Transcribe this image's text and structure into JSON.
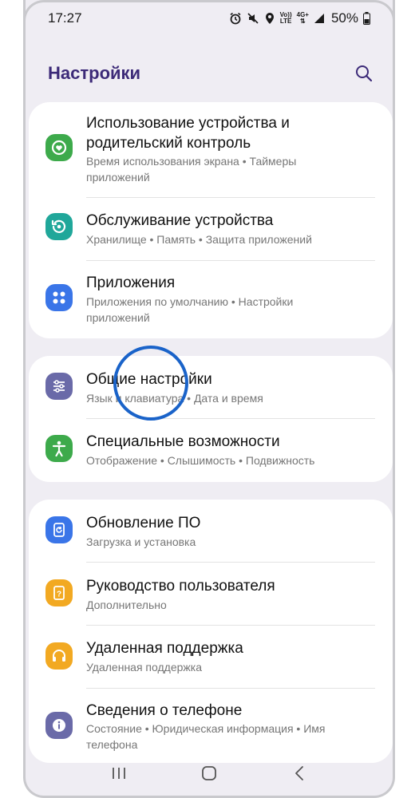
{
  "status_bar": {
    "time": "17:27",
    "volte_top": "Vo))",
    "volte_bottom": "LTE",
    "network_top": "4G+",
    "battery": "50%"
  },
  "header": {
    "title": "Настройки",
    "search_icon": "search-icon"
  },
  "colors": {
    "title": "#3c2a78",
    "background": "#efedf3",
    "tap_indicator": "#1a63c9"
  },
  "groups": [
    {
      "items": [
        {
          "title_line1": "Использование устройства и",
          "title_line2": "родительский контроль",
          "sub_line1": "Время использования экрана • Таймеры",
          "sub_line2": "приложений",
          "icon": "digital-wellbeing-icon",
          "color": "#3daa4b"
        },
        {
          "title_line1": "Обслуживание устройства",
          "sub_line1": "Хранилище • Память • Защита приложений",
          "icon": "device-care-icon",
          "color": "#20a79a"
        },
        {
          "title_line1": "Приложения",
          "sub_line1": "Приложения по умолчанию • Настройки",
          "sub_line2": "приложений",
          "icon": "apps-icon",
          "color": "#3a75e8"
        }
      ]
    },
    {
      "items": [
        {
          "title_line1": "Общие настройки",
          "sub_line1": "Язык и клавиатура • Дата и время",
          "icon": "general-settings-icon",
          "color": "#6a6aa8"
        },
        {
          "title_line1": "Специальные возможности",
          "sub_line1": "Отображение • Слышимость • Подвижность",
          "icon": "accessibility-icon",
          "color": "#3daa4b"
        }
      ]
    },
    {
      "items": [
        {
          "title_line1": "Обновление ПО",
          "sub_line1": "Загрузка и установка",
          "icon": "software-update-icon",
          "color": "#3a75e8"
        },
        {
          "title_line1": "Руководство пользователя",
          "sub_line1": "Дополнительно",
          "icon": "user-manual-icon",
          "color": "#f2a922"
        },
        {
          "title_line1": "Удаленная поддержка",
          "sub_line1": "Удаленная поддержка",
          "icon": "remote-support-icon",
          "color": "#f2a922"
        },
        {
          "title_line1": "Сведения о телефоне",
          "sub_line1": "Состояние • Юридическая информация • Имя",
          "sub_line2": "телефона",
          "icon": "about-phone-icon",
          "color": "#6a6aa8"
        }
      ]
    }
  ],
  "nav": {
    "recents_icon": "recents-icon",
    "home_icon": "home-icon",
    "back_icon": "back-icon"
  }
}
